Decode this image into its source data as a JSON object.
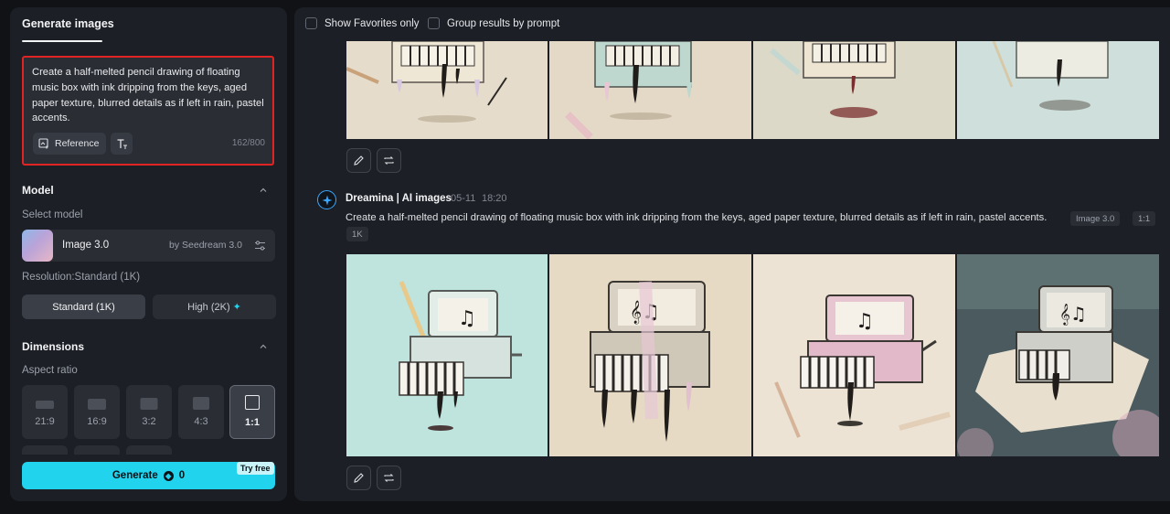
{
  "left_panel": {
    "tab_label": "Generate images",
    "prompt": {
      "text": "Create a half-melted pencil drawing of floating music box with ink dripping from the keys, aged paper texture, blurred details as if left in rain, pastel accents.",
      "reference_label": "Reference",
      "char_count": "162/800"
    },
    "model": {
      "section_title": "Model",
      "select_label": "Select model",
      "name": "Image 3.0",
      "by": "by Seedream 3.0"
    },
    "resolution": {
      "label": "Resolution:Standard (1K)",
      "standard_label": "Standard (1K)",
      "high_label": "High (2K)",
      "selected": "Standard (1K)"
    },
    "dimensions": {
      "section_title": "Dimensions",
      "aspect_label": "Aspect ratio",
      "ratios": [
        "21:9",
        "16:9",
        "3:2",
        "4:3",
        "1:1"
      ],
      "selected": "1:1"
    },
    "generate": {
      "label": "Generate",
      "credits": "0",
      "badge": "Try free",
      "accent": "#22d3ee"
    }
  },
  "right_panel": {
    "filters": {
      "favorites_label": "Show Favorites only",
      "group_label": "Group results by prompt"
    },
    "message": {
      "sender": "Dreamina | AI images",
      "date": "05-11",
      "time": "18:20",
      "prompt": "Create a half-melted pencil drawing of floating music box with ink dripping from the keys, aged paper texture, blurred details as if left in rain, pastel accents.",
      "chips": [
        "Image 3.0",
        "1:1",
        "1K"
      ]
    },
    "icons": {
      "edit": "pencil-icon",
      "regenerate": "repeat-icon",
      "bot": "sparkle-star-icon"
    }
  }
}
